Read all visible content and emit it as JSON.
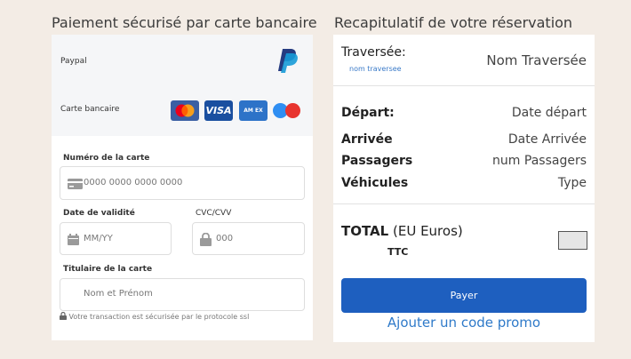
{
  "payment": {
    "title": "Paiement sécurisé par carte bancaire",
    "methods": {
      "paypal_label": "Paypal",
      "card_label": "Carte bancaire",
      "card_brands": {
        "visa": "VISA",
        "amex": "AM EX"
      }
    },
    "card_number": {
      "label": "Numéro de la carte",
      "placeholder": "0000 0000 0000 0000"
    },
    "validity": {
      "label": "Date de validité",
      "placeholder": "MM/YY"
    },
    "cvc": {
      "label": "CVC/CVV",
      "placeholder": "000"
    },
    "holder": {
      "label": "Titulaire de la carte",
      "placeholder": "Nom et Prénom"
    },
    "ssl_note": "Votre transaction est sécurisée par le protocole ssl"
  },
  "summary": {
    "title": "Recapitulatif de votre réservation",
    "crossing_label": "Traversée:",
    "crossing_sub": "nom traversee",
    "crossing_value": "Nom Traversée",
    "departure_label": "Départ:",
    "departure_value": "Date départ",
    "arrival_label": "Arrivée",
    "arrival_value": "Date Arrivée",
    "passengers_label": "Passagers",
    "passengers_value": "num Passagers",
    "vehicles_label": "Véhicules",
    "vehicles_value": "Type",
    "total_label": "TOTAL",
    "total_currency": "(EU Euros)",
    "ttc": "TTC",
    "pay_button": "Payer",
    "promo_link": "Ajouter un code promo"
  },
  "colors": {
    "background": "#f3ece5",
    "pay_button": "#1e5fbf",
    "link": "#2f7ac9"
  }
}
